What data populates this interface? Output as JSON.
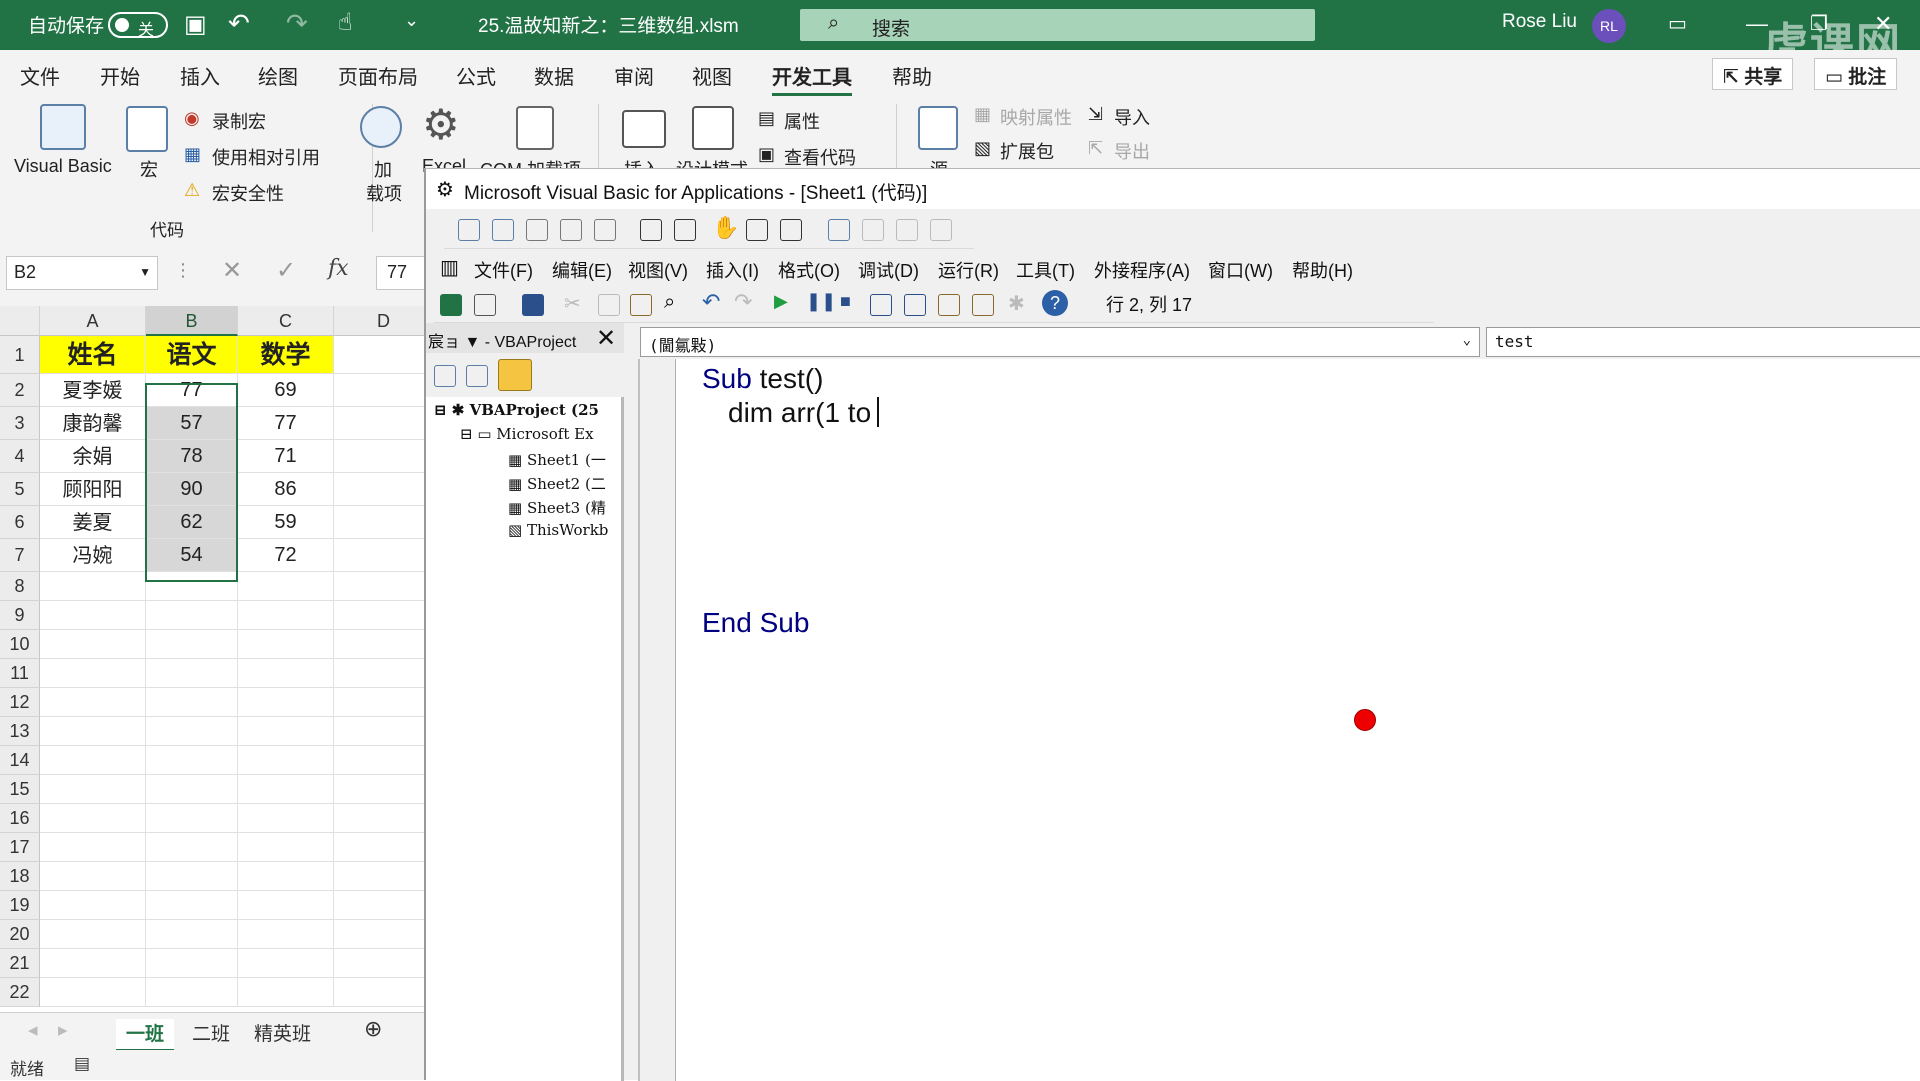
{
  "titlebar": {
    "autosave_label": "自动保存",
    "autosave_state": "关",
    "filename": "25.温故知新之：三维数组.xlsm",
    "search_placeholder": "搜索",
    "user_name": "Rose Liu",
    "user_initials": "RL",
    "watermark": "虎课网"
  },
  "menu": {
    "tabs": [
      "文件",
      "开始",
      "插入",
      "绘图",
      "页面布局",
      "公式",
      "数据",
      "审阅",
      "视图",
      "开发工具",
      "帮助"
    ],
    "active": "开发工具",
    "share": "共享",
    "comments": "批注"
  },
  "ribbon": {
    "visual_basic": "Visual Basic",
    "macros": "宏",
    "record_macro": "录制宏",
    "relative_refs": "使用相对引用",
    "macro_security": "宏安全性",
    "group_code": "代码",
    "addins_1": "加",
    "addins_2": "载项",
    "excel_addins": "Excel",
    "com_addins": "COM 加载项",
    "insert": "插入",
    "design_mode": "设计模式",
    "properties": "属性",
    "view_code": "查看代码",
    "source": "源",
    "map_props": "映射属性",
    "expansion_packs": "扩展包",
    "import": "导入",
    "export": "导出"
  },
  "formula": {
    "name_box": "B2",
    "fx": "fx",
    "value": "77"
  },
  "sheet": {
    "columns": [
      "A",
      "B",
      "C",
      "D"
    ],
    "row_numbers": [
      "1",
      "2",
      "3",
      "4",
      "5",
      "6",
      "7",
      "8",
      "9",
      "10",
      "11",
      "12",
      "13",
      "14",
      "15",
      "16",
      "17",
      "18",
      "19",
      "20",
      "21",
      "22"
    ],
    "header": [
      "姓名",
      "语文",
      "数学"
    ],
    "rows": [
      [
        "夏李媛",
        "77",
        "69"
      ],
      [
        "康韵馨",
        "57",
        "77"
      ],
      [
        "余娟",
        "78",
        "71"
      ],
      [
        "顾阳阳",
        "90",
        "86"
      ],
      [
        "姜夏",
        "62",
        "59"
      ],
      [
        "冯婉",
        "54",
        "72"
      ]
    ]
  },
  "sheet_tabs": [
    "一班",
    "二班",
    "精英班"
  ],
  "status": "就绪",
  "vbe": {
    "title": "Microsoft Visual Basic for Applications - [Sheet1 (代码)]",
    "menu": [
      "文件(F)",
      "编辑(E)",
      "视图(V)",
      "插入(I)",
      "格式(O)",
      "调试(D)",
      "运行(R)",
      "工具(T)",
      "外接程序(A)",
      "窗口(W)",
      "帮助(H)"
    ],
    "position": "行 2, 列 17",
    "project_title": "宸ョ ▼ - VBAProject",
    "tree": [
      "VBAProject (25",
      "Microsoft Ex",
      "Sheet1 (一",
      "Sheet2 (二",
      "Sheet3 (精",
      "ThisWorkb"
    ],
    "object_combo": "(閫氱敤)",
    "proc_combo": "test",
    "code": {
      "line1_kw": "Sub",
      "line1_rest": " test()",
      "line2": "dim arr(1 to",
      "line3": "End Sub"
    }
  },
  "colors": {
    "excel_green": "#217346",
    "header_fill": "#ffff00",
    "keyword": "#000080",
    "pointer_dot": "#ee0000"
  }
}
